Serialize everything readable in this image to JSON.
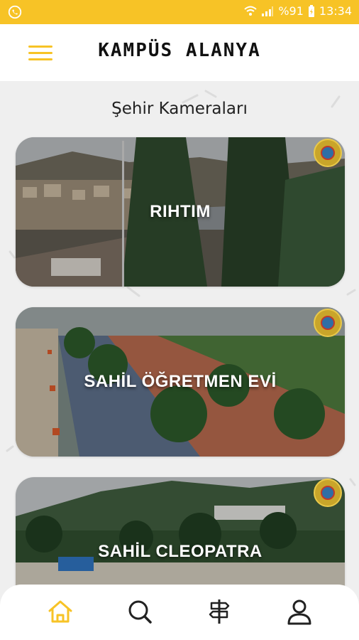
{
  "status_bar": {
    "signal_text": "%91",
    "time": "13:34"
  },
  "app_bar": {
    "title": "KAMPÜS ALANYA"
  },
  "section": {
    "title": "Şehir Kameraları"
  },
  "cameras": [
    {
      "label": "RIHTIM"
    },
    {
      "label": "SAHİL ÖĞRETMEN EVİ"
    },
    {
      "label": "SAHİL CLEOPATRA"
    }
  ],
  "bottom_nav": {
    "items": [
      {
        "icon": "home-icon",
        "active": true
      },
      {
        "icon": "search-icon",
        "active": false
      },
      {
        "icon": "signpost-icon",
        "active": false
      },
      {
        "icon": "profile-icon",
        "active": false
      }
    ]
  },
  "colors": {
    "accent": "#f7c326",
    "background": "#efefef"
  }
}
